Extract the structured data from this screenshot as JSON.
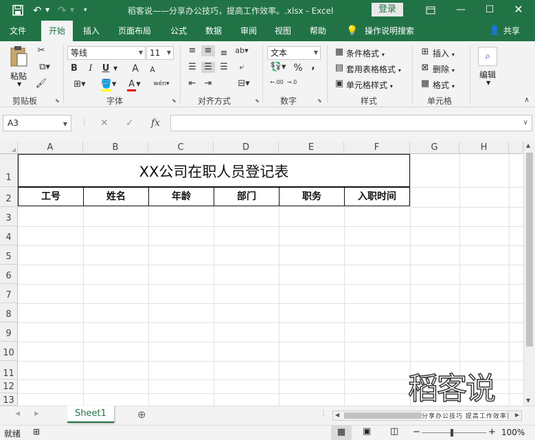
{
  "window": {
    "title": "稻客说——分享办公技巧，提高工作效率。.xlsx - Excel",
    "login_label": "登录",
    "minimize_icon": "minimize-icon",
    "restore_icon": "restore-icon",
    "close_icon": "close-icon"
  },
  "quick_access": {
    "save_icon": "save-icon",
    "undo_icon": "undo-icon",
    "redo_icon": "redo-icon",
    "customize_icon": "customize-icon"
  },
  "tabs": {
    "file": "文件",
    "home": "开始",
    "insert": "插入",
    "page_layout": "页面布局",
    "formulas": "公式",
    "data": "数据",
    "review": "审阅",
    "view": "视图",
    "help": "帮助",
    "tell_me": "操作说明搜索",
    "share": "共享"
  },
  "ribbon": {
    "clipboard": {
      "paste": "粘贴",
      "label": "剪贴板"
    },
    "font": {
      "name": "等线",
      "size": "11",
      "label": "字体",
      "bold": "B",
      "italic": "I",
      "underline": "U",
      "grow": "A",
      "shrink": "A",
      "phonetic": "wén",
      "font_color_glyph": "A"
    },
    "alignment": {
      "label": "对齐方式",
      "orientation": "ab"
    },
    "number": {
      "format": "文本",
      "label": "数字",
      "percent": "%",
      "comma": ",",
      "inc_decimal": ".00",
      "dec_decimal": ".0"
    },
    "styles": {
      "conditional": "条件格式",
      "table": "套用表格格式",
      "cell_styles": "单元格样式",
      "label": "样式"
    },
    "cells": {
      "insert": "插入",
      "delete": "删除",
      "format": "格式",
      "label": "单元格"
    },
    "editing": {
      "label": "编辑"
    }
  },
  "formula_bar": {
    "name_box": "A3",
    "cancel": "✕",
    "enter": "✓",
    "fx": "fx",
    "content": ""
  },
  "sheet": {
    "columns": [
      "A",
      "B",
      "C",
      "D",
      "E",
      "F",
      "G",
      "H"
    ],
    "rows": [
      "1",
      "2",
      "3",
      "4",
      "5",
      "6",
      "7",
      "8",
      "9",
      "10",
      "11",
      "12",
      "13"
    ],
    "title": "XX公司在职人员登记表",
    "headers": [
      "工号",
      "姓名",
      "年龄",
      "部门",
      "职务",
      "入职时间"
    ]
  },
  "sheet_tabs": {
    "active": "Sheet1",
    "add": "⊕"
  },
  "status": {
    "ready": "就绪",
    "zoom": "100%",
    "minus": "−",
    "plus": "+"
  },
  "watermark": {
    "logo": "稻客说",
    "tagline": "分享办公技巧 提高工作效率"
  }
}
